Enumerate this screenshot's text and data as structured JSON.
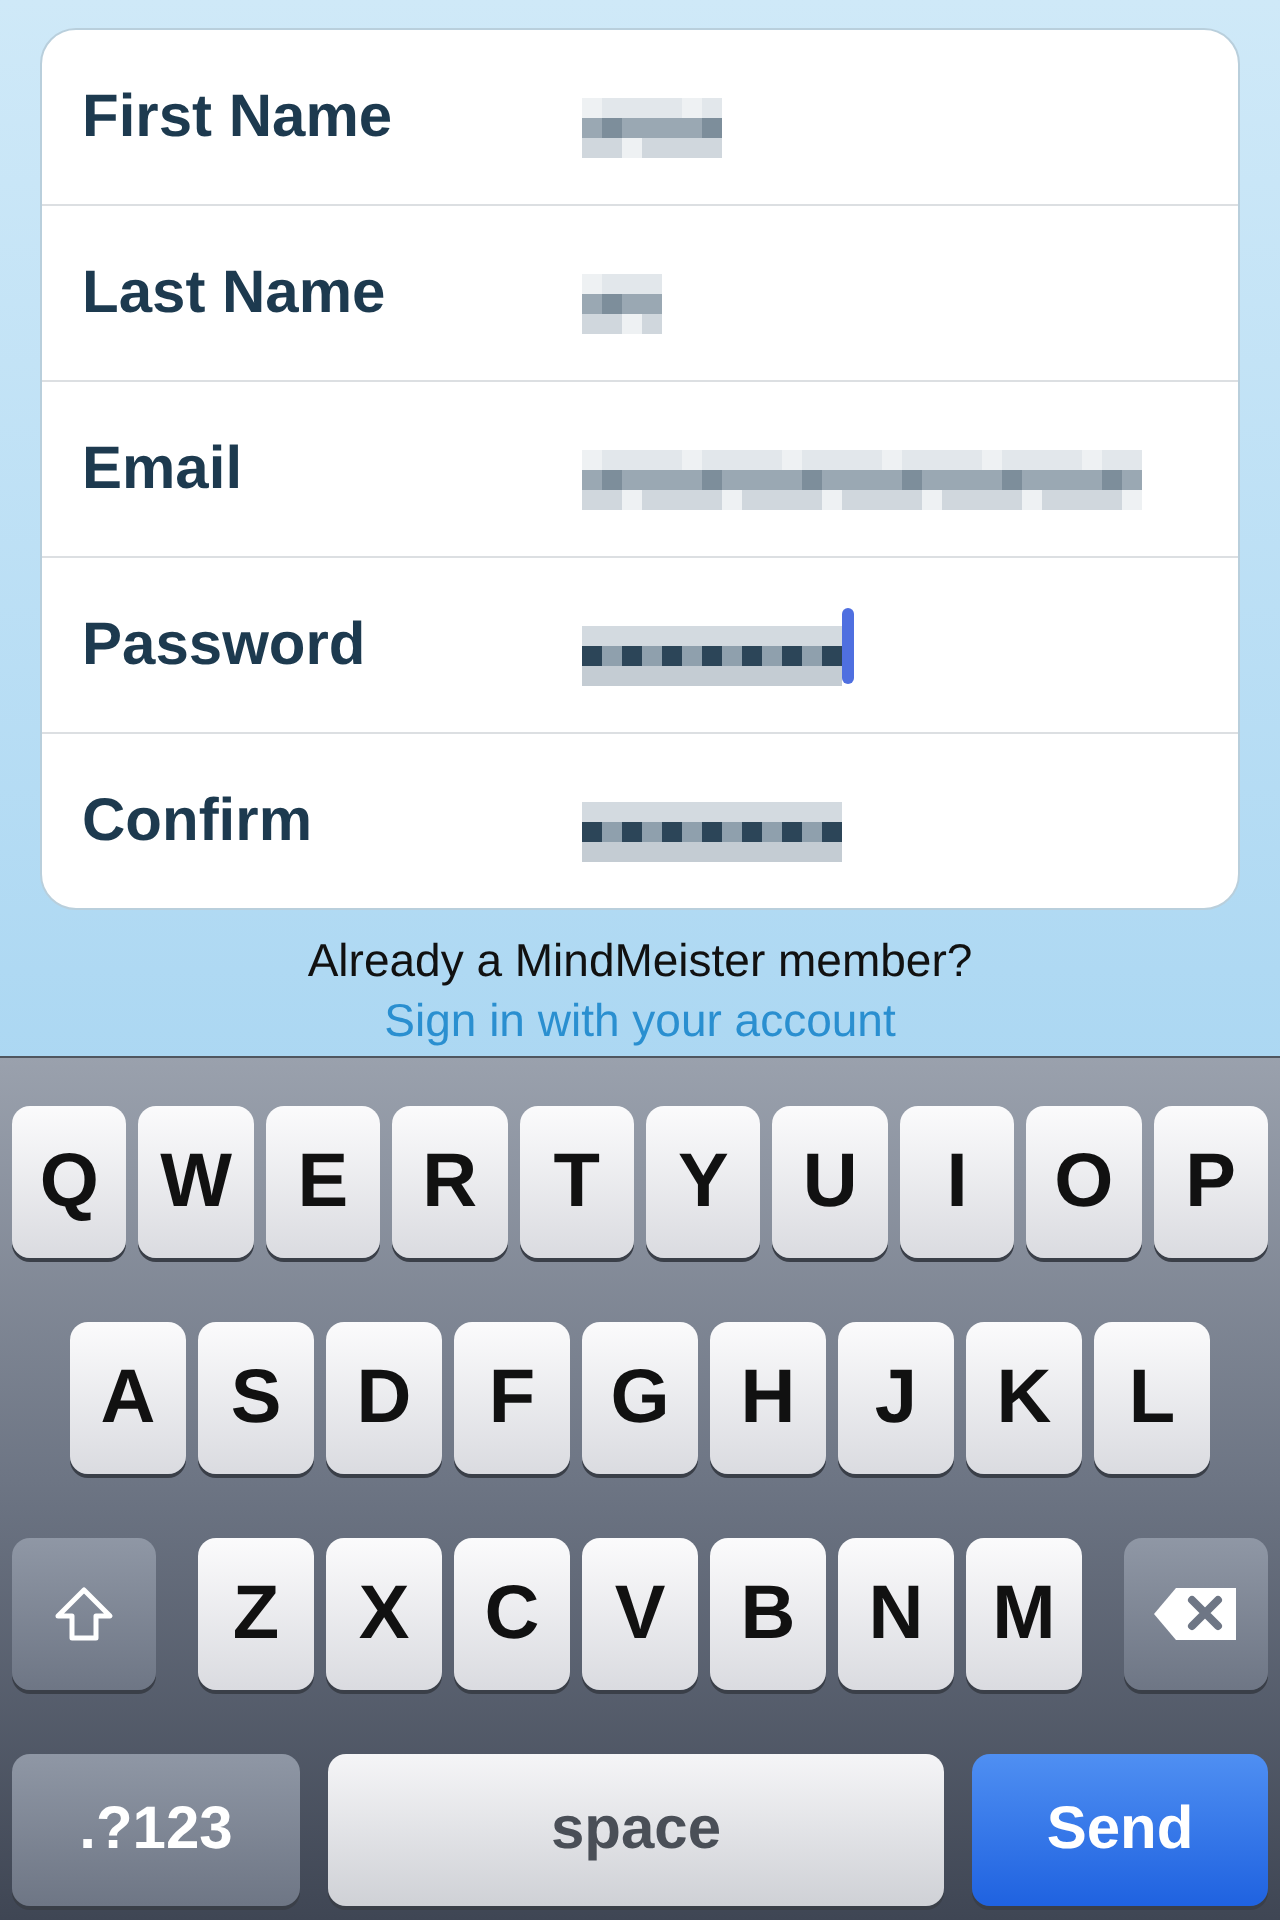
{
  "form": {
    "fields": [
      {
        "label": "First Name",
        "redacted": true,
        "focused": false
      },
      {
        "label": "Last Name",
        "redacted": true,
        "focused": false
      },
      {
        "label": "Email",
        "redacted": true,
        "focused": false
      },
      {
        "label": "Password",
        "redacted": true,
        "focused": true
      },
      {
        "label": "Confirm",
        "redacted": true,
        "focused": false
      }
    ]
  },
  "signin_prompt": "Already a MindMeister member?",
  "signin_link": "Sign in with your account",
  "keyboard": {
    "rows": [
      {
        "keys": [
          {
            "kind": "letter",
            "label": "Q"
          },
          {
            "kind": "letter",
            "label": "W"
          },
          {
            "kind": "letter",
            "label": "E"
          },
          {
            "kind": "letter",
            "label": "R"
          },
          {
            "kind": "letter",
            "label": "T"
          },
          {
            "kind": "letter",
            "label": "Y"
          },
          {
            "kind": "letter",
            "label": "U"
          },
          {
            "kind": "letter",
            "label": "I"
          },
          {
            "kind": "letter",
            "label": "O"
          },
          {
            "kind": "letter",
            "label": "P"
          }
        ]
      },
      {
        "keys": [
          {
            "kind": "letter",
            "label": "A"
          },
          {
            "kind": "letter",
            "label": "S"
          },
          {
            "kind": "letter",
            "label": "D"
          },
          {
            "kind": "letter",
            "label": "F"
          },
          {
            "kind": "letter",
            "label": "G"
          },
          {
            "kind": "letter",
            "label": "H"
          },
          {
            "kind": "letter",
            "label": "J"
          },
          {
            "kind": "letter",
            "label": "K"
          },
          {
            "kind": "letter",
            "label": "L"
          }
        ]
      },
      {
        "keys": [
          {
            "kind": "shift"
          },
          {
            "kind": "letter",
            "label": "Z"
          },
          {
            "kind": "letter",
            "label": "X"
          },
          {
            "kind": "letter",
            "label": "C"
          },
          {
            "kind": "letter",
            "label": "V"
          },
          {
            "kind": "letter",
            "label": "B"
          },
          {
            "kind": "letter",
            "label": "N"
          },
          {
            "kind": "letter",
            "label": "M"
          },
          {
            "kind": "delete"
          }
        ]
      },
      {
        "keys": [
          {
            "kind": "mode",
            "label": ".?123"
          },
          {
            "kind": "space",
            "label": "space"
          },
          {
            "kind": "send",
            "label": "Send"
          }
        ]
      }
    ]
  }
}
